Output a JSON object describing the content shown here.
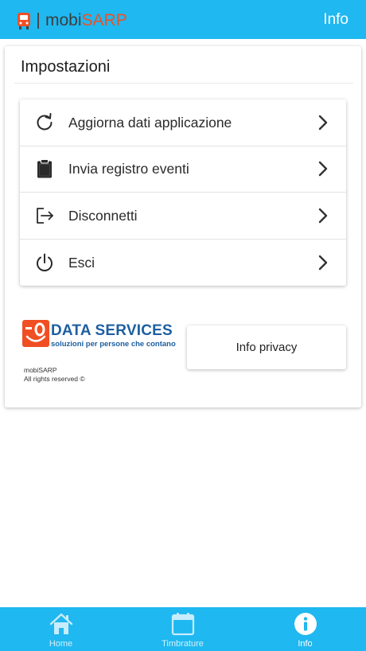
{
  "app": {
    "name_part1": "mobi",
    "name_part2": "SARP",
    "page_title": "Info",
    "colors": {
      "primary": "#1fb8f0",
      "brand_orange": "#f04f23",
      "brand_blue": "#1d5fa0"
    }
  },
  "settings": {
    "title": "Impostazioni",
    "items": [
      {
        "label": "Aggiorna dati applicazione",
        "icon": "refresh-icon"
      },
      {
        "label": "Invia registro eventi",
        "icon": "clipboard-icon"
      },
      {
        "label": "Disconnetti",
        "icon": "logout-icon"
      },
      {
        "label": "Esci",
        "icon": "power-icon"
      }
    ]
  },
  "company": {
    "name": "DATA SERVICES",
    "tagline": "soluzioni per persone che contano"
  },
  "footer": {
    "app_name": "mobiSARP",
    "rights": "All rights reserved ©",
    "privacy_button": "Info privacy"
  },
  "bottom_nav": [
    {
      "label": "Home",
      "icon": "home-icon",
      "active": false
    },
    {
      "label": "Timbrature",
      "icon": "calendar-icon",
      "active": false
    },
    {
      "label": "Info",
      "icon": "info-icon",
      "active": true
    }
  ]
}
